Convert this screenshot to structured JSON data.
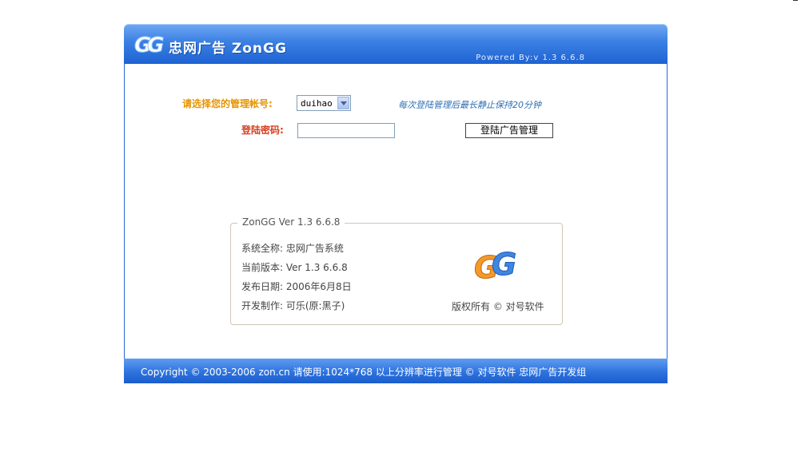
{
  "header": {
    "title": "忠网广告 ZonGG",
    "powered": "Powered By:v 1.3 6.6.8"
  },
  "login": {
    "account_label": "请选择您的管理帐号:",
    "account_selected": "duihao",
    "hint": "每次登陆管理后最长静止保持20分钟",
    "password_label": "登陆密码:",
    "password_value": "",
    "submit_label": "登陆广告管理"
  },
  "info": {
    "legend": "ZonGG Ver 1.3 6.6.8",
    "lines": [
      "系统全称: 忠网广告系统",
      "当前版本: Ver 1.3 6.6.8",
      "发布日期: 2006年6月8日",
      "开发制作: 可乐(原:黑子)"
    ],
    "rights": "版权所有 © 对号软件"
  },
  "footer": {
    "text": "Copyright © 2003-2006 zon.cn 请使用:1024*768 以上分辨率进行管理 © 对号软件 忠网广告开发组"
  },
  "colors": {
    "header_blue": "#3a7fe3",
    "account_label": "#e69400",
    "password_label": "#d63d1e",
    "hint": "#2f6fb3"
  },
  "icons": [
    "gg-logo-icon",
    "select-arrow-icon"
  ]
}
